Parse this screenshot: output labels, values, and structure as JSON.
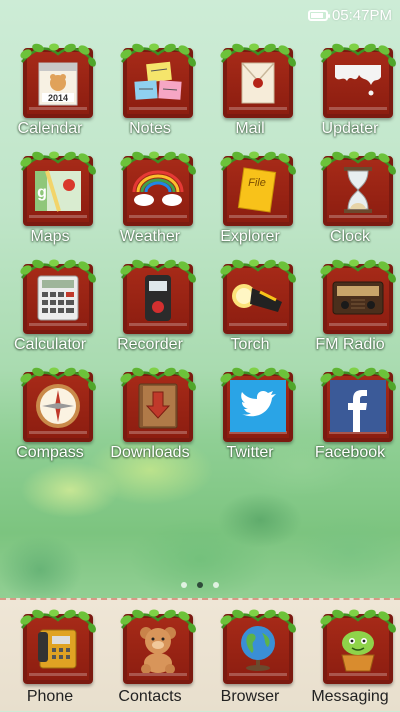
{
  "status": {
    "time": "05:47PM",
    "battery_level": 0.7
  },
  "apps_row1": [
    {
      "name": "calendar",
      "label": "Calendar",
      "icon": "calendar-icon",
      "badge": "2014"
    },
    {
      "name": "notes",
      "label": "Notes",
      "icon": "notes-icon"
    },
    {
      "name": "mail",
      "label": "Mail",
      "icon": "mail-icon"
    },
    {
      "name": "updater",
      "label": "Updater",
      "icon": "updater-icon"
    }
  ],
  "apps_row2": [
    {
      "name": "maps",
      "label": "Maps",
      "icon": "maps-icon"
    },
    {
      "name": "weather",
      "label": "Weather",
      "icon": "weather-icon"
    },
    {
      "name": "explorer",
      "label": "Explorer",
      "icon": "explorer-icon",
      "badge": "File"
    },
    {
      "name": "clock",
      "label": "Clock",
      "icon": "hourglass-icon"
    }
  ],
  "apps_row3": [
    {
      "name": "calculator",
      "label": "Calculator",
      "icon": "calculator-icon"
    },
    {
      "name": "recorder",
      "label": "Recorder",
      "icon": "recorder-icon"
    },
    {
      "name": "torch",
      "label": "Torch",
      "icon": "torch-icon"
    },
    {
      "name": "fm-radio",
      "label": "FM Radio",
      "icon": "radio-icon"
    }
  ],
  "apps_row4": [
    {
      "name": "compass",
      "label": "Compass",
      "icon": "compass-icon"
    },
    {
      "name": "downloads",
      "label": "Downloads",
      "icon": "downloads-icon"
    },
    {
      "name": "twitter",
      "label": "Twitter",
      "icon": "twitter-icon"
    },
    {
      "name": "facebook",
      "label": "Facebook",
      "icon": "facebook-icon"
    }
  ],
  "pager": {
    "pages": 3,
    "active": 1
  },
  "dock": [
    {
      "name": "phone",
      "label": "Phone",
      "icon": "phone-icon"
    },
    {
      "name": "contacts",
      "label": "Contacts",
      "icon": "teddy-bear-icon"
    },
    {
      "name": "browser",
      "label": "Browser",
      "icon": "globe-icon"
    },
    {
      "name": "messaging",
      "label": "Messaging",
      "icon": "messaging-icon"
    }
  ],
  "colors": {
    "frame": "#8c1d10",
    "vine": "#3e9b22",
    "leaf": "#6cc23a",
    "dock_bg": "#ece3d2"
  }
}
